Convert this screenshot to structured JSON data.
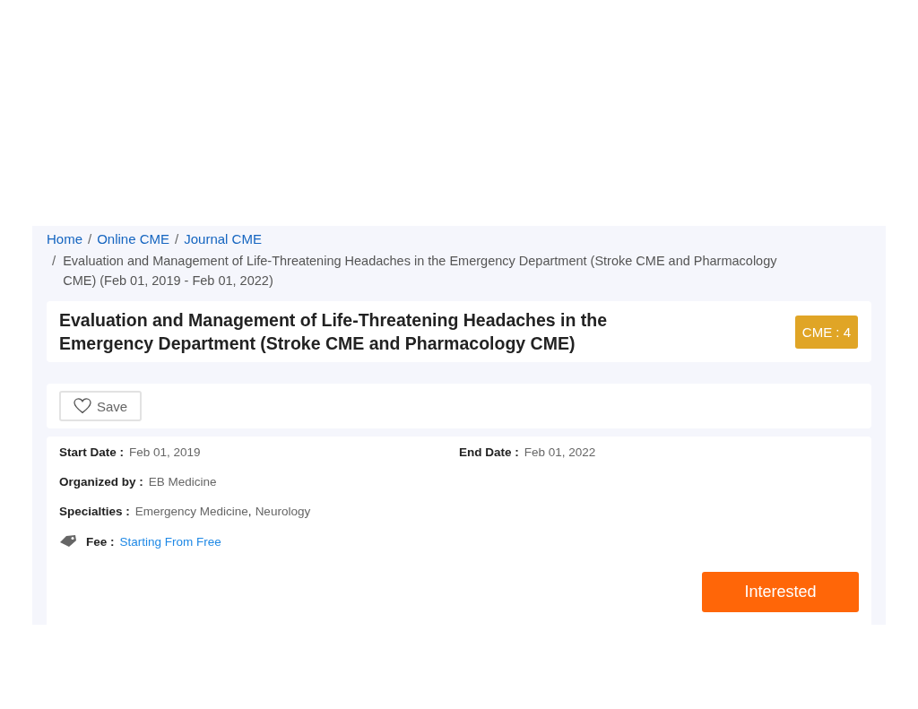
{
  "breadcrumb": {
    "items": [
      {
        "kind": "link",
        "text": "Home"
      },
      {
        "kind": "separator",
        "text": "/"
      },
      {
        "kind": "link",
        "text": "Online CME"
      },
      {
        "kind": "separator",
        "text": "/"
      },
      {
        "kind": "link",
        "text": "Journal CME"
      }
    ],
    "current_separator": "/",
    "current": "Evaluation and Management of Life-Threatening Headaches in the Emergency Department (Stroke CME and Pharmacology CME) (Feb 01, 2019 - Feb 01, 2022)"
  },
  "course": {
    "title": "Evaluation and Management of Life-Threatening Headaches in the Emergency Department (Stroke CME and Pharmacology CME)",
    "cme_badge": "CME : 4"
  },
  "save_button": {
    "label": "Save",
    "saved": false
  },
  "details": {
    "start_date": {
      "label": "Start Date :",
      "value": "Feb 01, 2019"
    },
    "end_date": {
      "label": "End Date :",
      "value": "Feb 01, 2022"
    },
    "organized_by": {
      "label": "Organized by :",
      "value": "EB Medicine"
    },
    "specialties": {
      "label": "Specialties :",
      "parts": [
        {
          "kind": "value",
          "text": "Emergency Medicine"
        },
        {
          "kind": "separator",
          "text": ","
        },
        {
          "kind": "value",
          "text": "Neurology"
        }
      ]
    },
    "fee": {
      "label": "Fee :",
      "value": "Starting From Free"
    }
  },
  "interested_button": {
    "label": "Interested"
  }
}
